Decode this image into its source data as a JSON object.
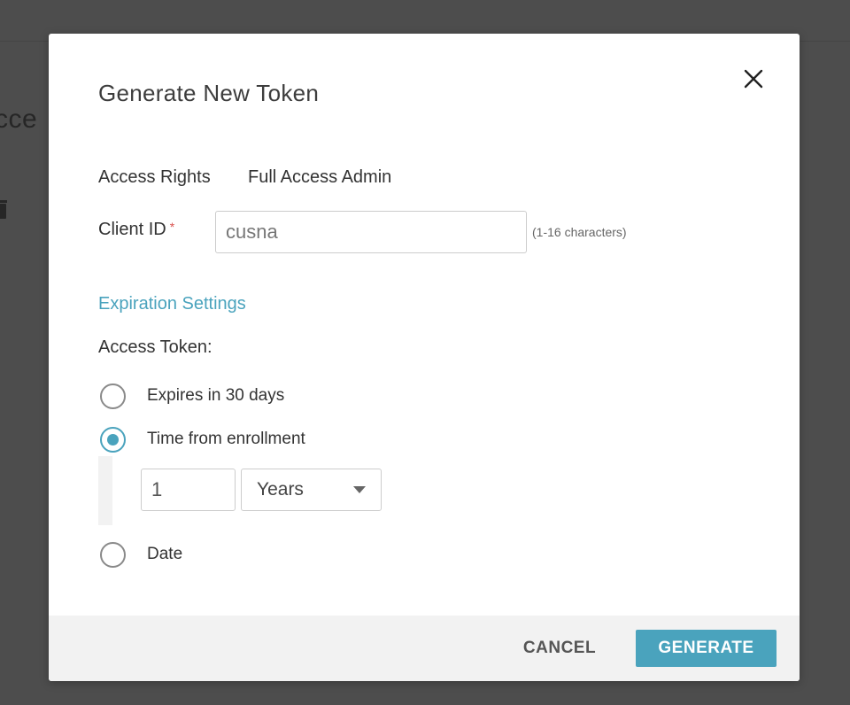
{
  "background": {
    "title_fragment": "cce"
  },
  "modal": {
    "title": "Generate New Token",
    "access_rights_label": "Access Rights",
    "access_rights_value": "Full Access Admin",
    "client_id_label": "Client ID",
    "required_marker": "*",
    "client_id_value": "cusna",
    "client_id_hint": "(1-16 characters)",
    "expiration_heading": "Expiration Settings",
    "access_token_label": "Access Token:",
    "options": [
      {
        "label": "Expires in 30 days",
        "selected": false
      },
      {
        "label": "Time from enrollment",
        "selected": true
      },
      {
        "label": "Date",
        "selected": false
      }
    ],
    "duration_value": "1",
    "duration_unit": "Years",
    "cancel_label": "CANCEL",
    "generate_label": "GENERATE"
  },
  "colors": {
    "accent": "#4aa3bd",
    "required": "#d9534f",
    "footer_bg": "#f2f2f2",
    "overlay": "#4d4d4d"
  },
  "icons": {
    "close": "close-icon",
    "dropdown": "caret-down-icon",
    "background_delete": "trash-icon"
  }
}
